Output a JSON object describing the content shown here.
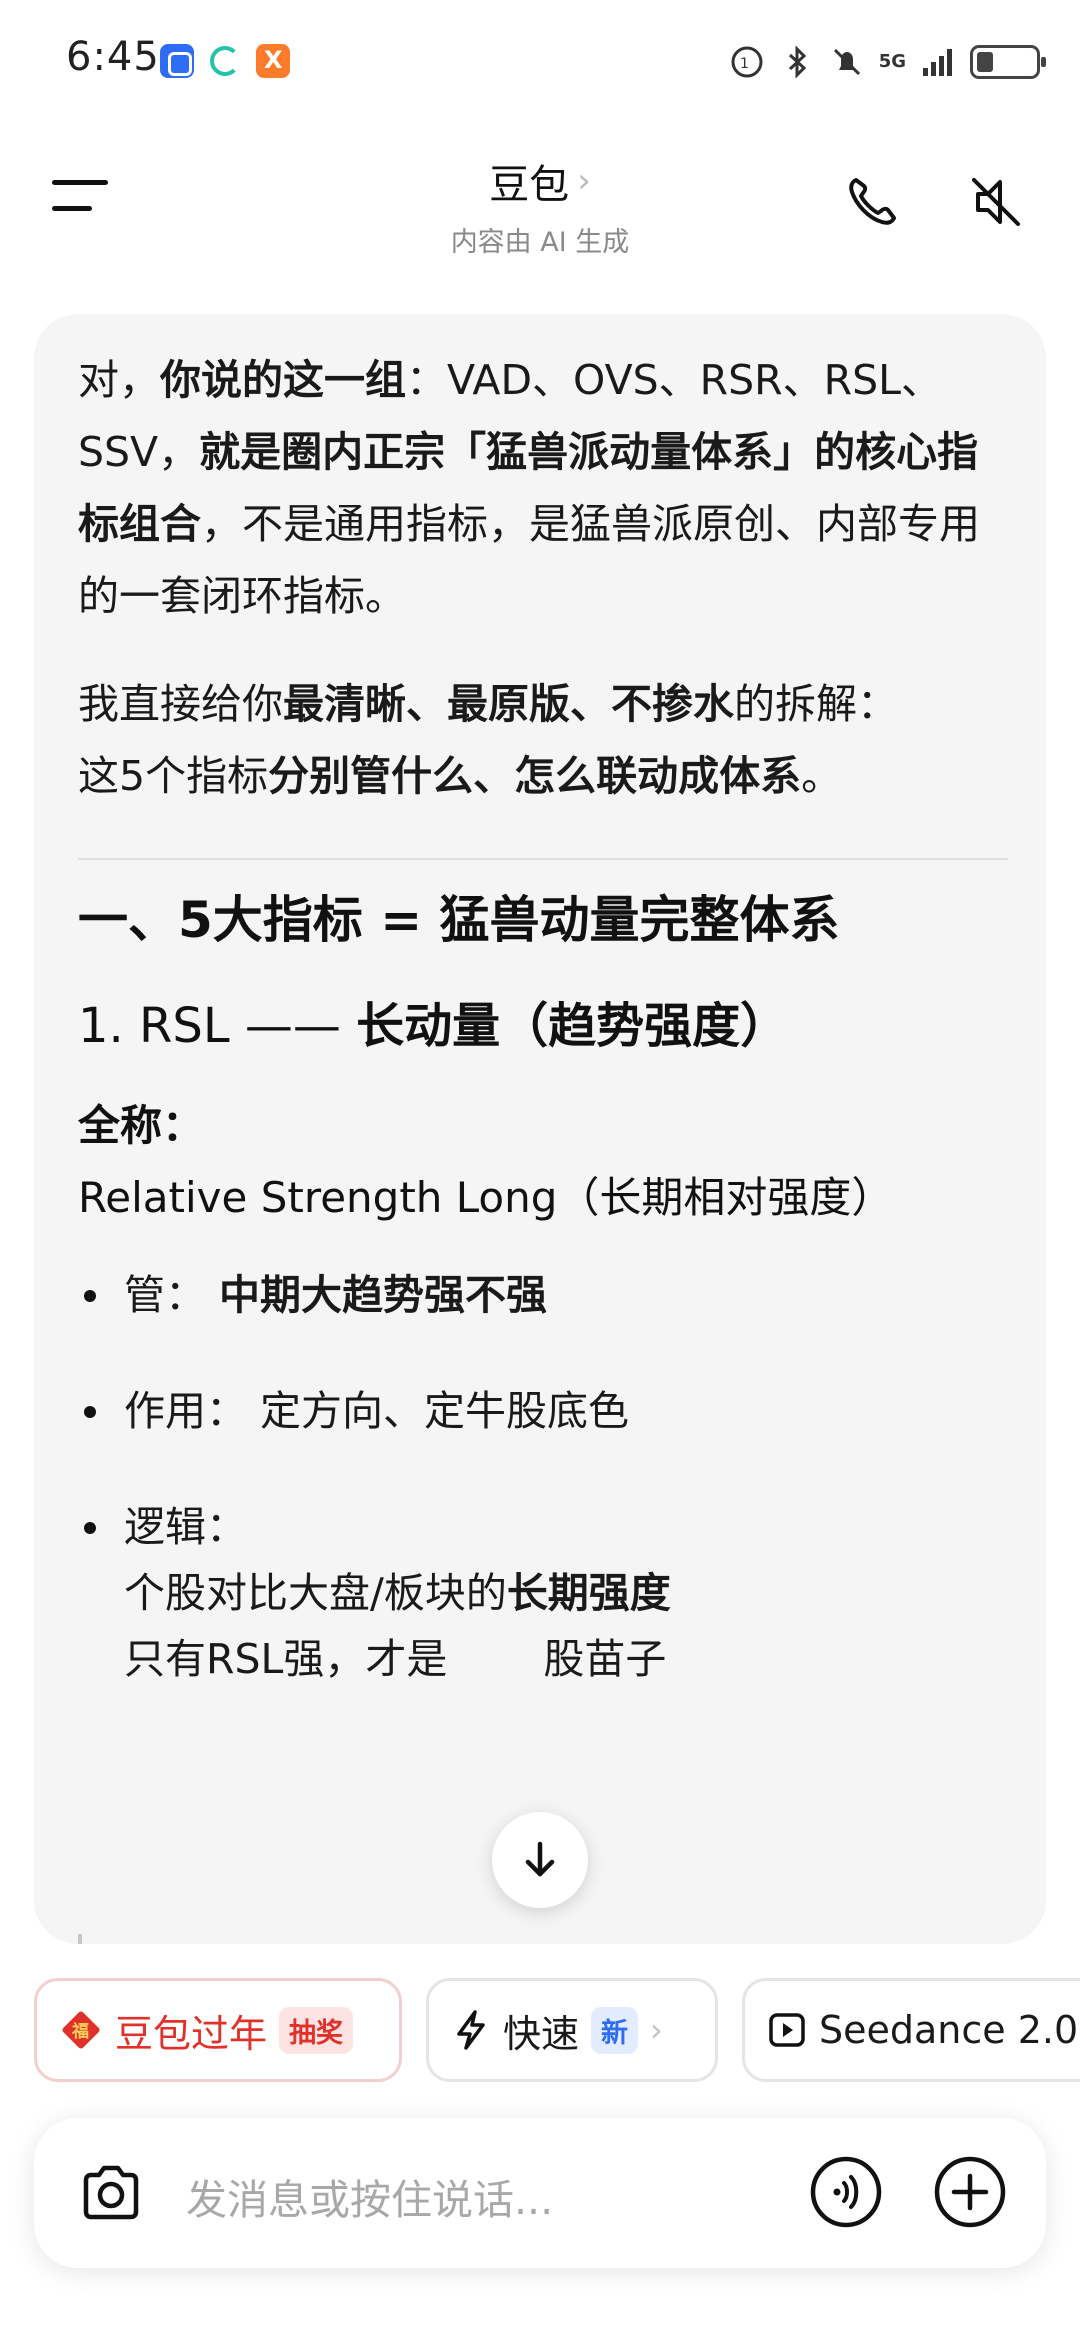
{
  "status_bar": {
    "time": "6:45",
    "network": "5G",
    "icons": [
      "app-blue-icon",
      "sync-ring-icon",
      "app-orange-icon",
      "data-saver-icon",
      "bluetooth-icon",
      "mute-bell-icon",
      "signal-icon",
      "battery-icon"
    ]
  },
  "header": {
    "title": "豆包",
    "title_chevron": "›",
    "subtitle": "内容由 AI 生成"
  },
  "message": {
    "para1": [
      {
        "t": "对，",
        "b": false
      },
      {
        "t": "你说的这一组",
        "b": true
      },
      {
        "t": "：VAD、OVS、RSR、RSL、SSV，",
        "b": false
      },
      {
        "t": "就是圈内正宗「猛兽派动量体系」的核心指标组合",
        "b": true
      },
      {
        "t": "，不是通用指标，是猛兽派原创、内部专用的一套闭环指标。",
        "b": false
      }
    ],
    "para2": [
      {
        "t": "我直接给你",
        "b": false
      },
      {
        "t": "最清晰、最原版、不掺水",
        "b": true
      },
      {
        "t": "的拆解：",
        "b": false
      }
    ],
    "para3": [
      {
        "t": "这5个指标",
        "b": false
      },
      {
        "t": "分别管什么、怎么联动成体系",
        "b": true
      },
      {
        "t": "。",
        "b": false
      }
    ],
    "heading1": "一、5大指标 = 猛兽动量完整体系",
    "heading2_prefix": "1. RSL —— ",
    "heading2_main": "长动量（趋势强度）",
    "fullname_label": "全称：",
    "fullname_value": "Relative Strength Long（长期相对强度）",
    "bullet1_label": "管：",
    "bullet1_value": "中期大趋势强不强",
    "bullet2_label": "作用：",
    "bullet2_value": "定方向、定牛股底色",
    "bullet3_label": "逻辑：",
    "bullet3_line1_prefix": "个股对比大盘/板块的",
    "bullet3_line1_bold": "长期强度",
    "bullet3_line2": "只有RSL强，才是",
    "bullet3_line2_tail": "股苗子"
  },
  "chips": {
    "chip1_label": "豆包过年",
    "chip1_tag": "抽奖",
    "chip2_label": "快速",
    "chip2_tag": "新",
    "chip2_chevron": "›",
    "chip3_label": "Seedance 2.0"
  },
  "input": {
    "placeholder": "发消息或按住说话..."
  },
  "colors": {
    "accent_red": "#e0322a",
    "accent_blue": "#2f6cf6",
    "card_bg": "#f5f5f6"
  }
}
